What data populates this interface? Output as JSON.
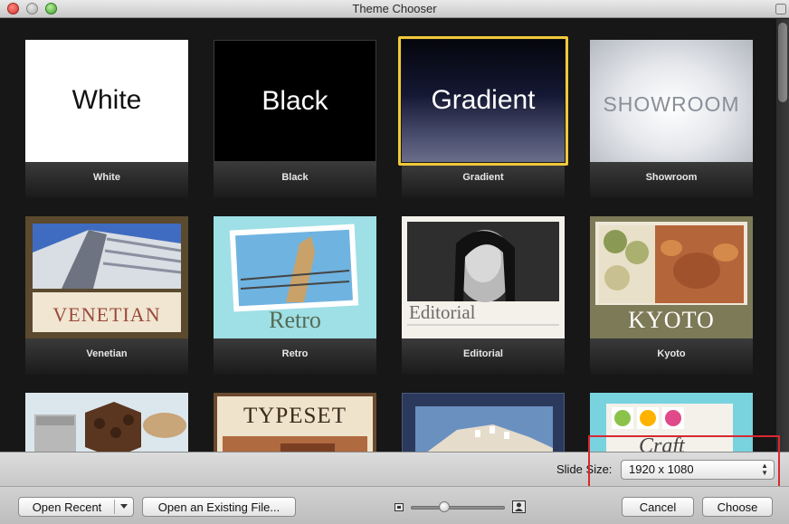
{
  "window": {
    "title": "Theme Chooser"
  },
  "themes": [
    {
      "label": "White",
      "preview_text": "White"
    },
    {
      "label": "Black",
      "preview_text": "Black"
    },
    {
      "label": "Gradient",
      "preview_text": "Gradient"
    },
    {
      "label": "Showroom",
      "preview_text": "SHOWROOM"
    },
    {
      "label": "Venetian",
      "preview_text": "VENETIAN"
    },
    {
      "label": "Retro",
      "preview_text": "Retro"
    },
    {
      "label": "Editorial",
      "preview_text": "Editorial"
    },
    {
      "label": "Kyoto",
      "preview_text": "KYOTO"
    },
    {
      "label": "",
      "preview_text": ""
    },
    {
      "label": "",
      "preview_text": "TYPESET"
    },
    {
      "label": "",
      "preview_text": ""
    },
    {
      "label": "",
      "preview_text": "Craft"
    }
  ],
  "selected_theme": "Gradient",
  "slide_size": {
    "label": "Slide Size:",
    "value": "1920 x 1080"
  },
  "buttons": {
    "open_recent": "Open Recent",
    "open_existing": "Open an Existing File...",
    "cancel": "Cancel",
    "choose": "Choose"
  },
  "colors": {
    "selection": "#f0c93a",
    "annotation_box": "#d9282f"
  }
}
